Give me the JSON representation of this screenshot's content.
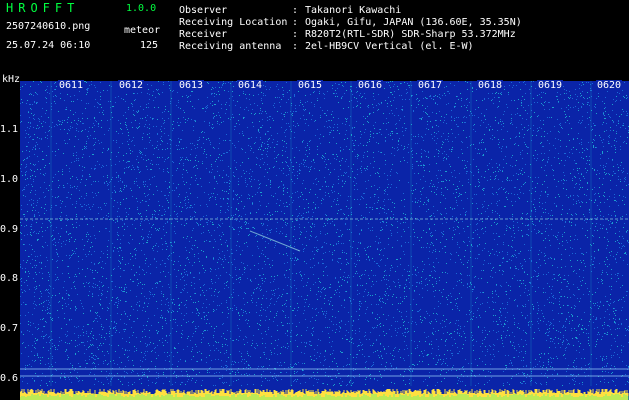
{
  "header": {
    "logo": "HROFFT",
    "version": "1.0.0",
    "filename": "2507240610.png",
    "mode": "meteor",
    "timestamp": "25.07.24 06:10",
    "meteor_count": "125"
  },
  "info": [
    {
      "label": "Observer",
      "value": "Takanori Kawachi"
    },
    {
      "label": "Receiving Location",
      "value": "Ogaki, Gifu, JAPAN (136.60E, 35.35N)"
    },
    {
      "label": "Receiver",
      "value": "R820T2(RTL-SDR) SDR-Sharp 53.372MHz"
    },
    {
      "label": "Receiving antenna",
      "value": "2el-HB9CV Vertical (el. E-W)"
    }
  ],
  "axis": {
    "y_unit": "kHz",
    "y_ticks": [
      "1.1",
      "1.0",
      "0.9",
      "0.8",
      "0.7",
      "0.6"
    ],
    "x_ticks": [
      "0611",
      "0612",
      "0613",
      "0614",
      "0615",
      "0616",
      "0617",
      "0618",
      "0619",
      "0620"
    ]
  },
  "colors": {
    "background": "#0a24a8",
    "noise": "#22c8d8",
    "signal": "#b0fff0",
    "baseline": "#ffe040"
  }
}
